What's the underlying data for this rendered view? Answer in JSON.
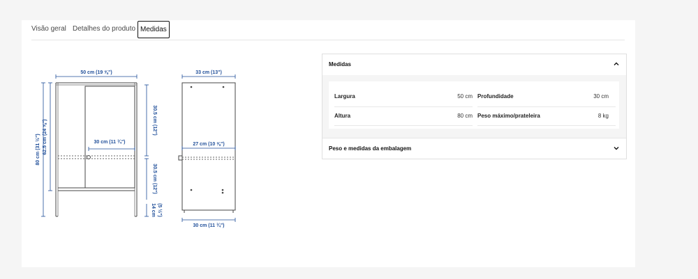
{
  "tabs": [
    {
      "label": "Visão geral",
      "active": false
    },
    {
      "label": "Detalhes do produto",
      "active": false
    },
    {
      "label": "Medidas",
      "active": true
    }
  ],
  "drawing": {
    "front": {
      "width_label": "50 cm (19 ⅝\")",
      "total_height_label": "80 cm (31 ½\")",
      "inner_height_label": "62.5 cm (24 ⅝\")",
      "shelf_depth_label": "30 cm (11 ¾\")",
      "upper_gap_label": "30.5 cm (12\")",
      "lower_gap_label": "30.5 cm (12\")",
      "leg_height_label": "14 cm",
      "leg_height_label_in": "(5 ½\")"
    },
    "side": {
      "top_depth_label": "33 cm (13\")",
      "inner_depth_label": "27 cm (10 ⅝\")",
      "bottom_depth_label": "30 cm (11 ¾\")"
    }
  },
  "accordion": {
    "measures": {
      "title": "Medidas",
      "expanded": true,
      "rows": [
        {
          "label": "Largura",
          "value": "50 cm",
          "label2": "Profundidade",
          "value2": "30 cm"
        },
        {
          "label": "Altura",
          "value": "80 cm",
          "label2": "Peso máximo/prateleira",
          "value2": "8 kg"
        }
      ]
    },
    "package": {
      "title": "Peso e medidas da embalagem",
      "expanded": false
    }
  },
  "colors": {
    "dimension": "#1f4e99",
    "line": "#444444"
  }
}
